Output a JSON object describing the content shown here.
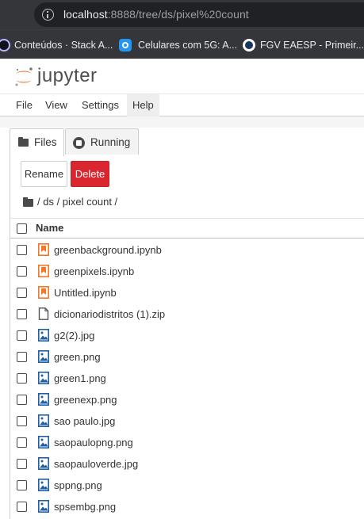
{
  "browser": {
    "url_host": "localhost",
    "url_rest": ":8888/tree/ds/pixel%20count",
    "bookmarks": [
      {
        "label": "Conteúdos · Stack A..."
      },
      {
        "label": "Celulares com 5G: A..."
      },
      {
        "label": "FGV EAESP - Primeir..."
      }
    ]
  },
  "header": {
    "logo_text": "jupyter"
  },
  "menubar": {
    "file": "File",
    "view": "View",
    "settings": "Settings",
    "help": "Help"
  },
  "tabs": {
    "files": "Files",
    "running": "Running"
  },
  "toolbar": {
    "rename": "Rename",
    "delete": "Delete"
  },
  "breadcrumb": {
    "path": "/ ds / pixel count /"
  },
  "list": {
    "column_name": "Name",
    "files": [
      {
        "name": "greenbackground.ipynb",
        "type": "notebook"
      },
      {
        "name": "greenpixels.ipynb",
        "type": "notebook"
      },
      {
        "name": "Untitled.ipynb",
        "type": "notebook"
      },
      {
        "name": "dicionariodistritos (1).zip",
        "type": "file"
      },
      {
        "name": "g2(2).jpg",
        "type": "image"
      },
      {
        "name": "green.png",
        "type": "image"
      },
      {
        "name": "green1.png",
        "type": "image"
      },
      {
        "name": "greenexp.png",
        "type": "image"
      },
      {
        "name": "sao paulo.jpg",
        "type": "image"
      },
      {
        "name": "saopaulopng.png",
        "type": "image"
      },
      {
        "name": "saopauloverde.jpg",
        "type": "image"
      },
      {
        "name": "sppng.png",
        "type": "image"
      },
      {
        "name": "spsembg.png",
        "type": "image"
      }
    ]
  },
  "colors": {
    "notebook_icon": "#f37726",
    "image_icon": "#1e5fa6",
    "file_icon": "#555555",
    "delete_button": "#d9262f"
  }
}
